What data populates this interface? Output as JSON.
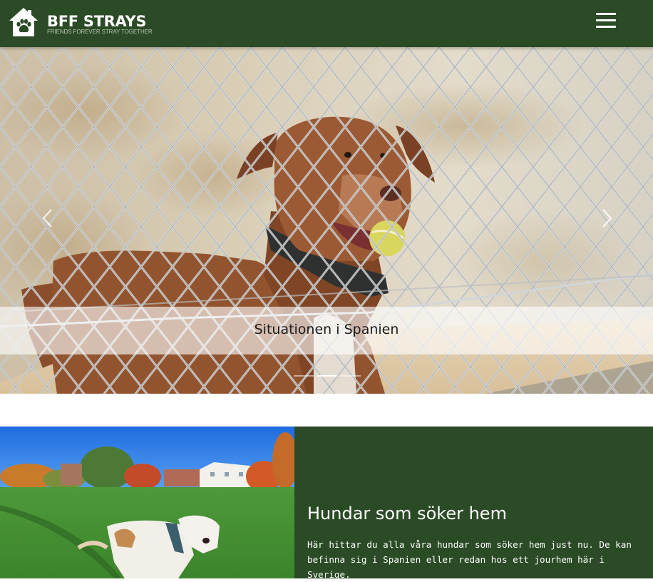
{
  "navbar": {
    "brand_name": "BFF STRAYS",
    "tagline": "FRIENDS FOREVER STRAY TOGETHER",
    "logo_icon": "house-paw-icon",
    "menu_icon": "hamburger-menu-icon"
  },
  "carousel": {
    "caption": "Situationen i Spanien",
    "prev_icon": "chevron-left-icon",
    "next_icon": "chevron-right-icon",
    "slide_count": 3,
    "active_slide": 2
  },
  "feature": {
    "title": "Hundar som söker hem",
    "text": "Här hittar du alla våra hundar som söker hem just nu. De kan befinna sig i Spanien eller redan hos ett jourhem här i Sverige."
  },
  "colors": {
    "brand_green": "#2b4a26",
    "text_light": "#ffffff",
    "caption_band": "rgba(255,255,255,0.62)"
  }
}
